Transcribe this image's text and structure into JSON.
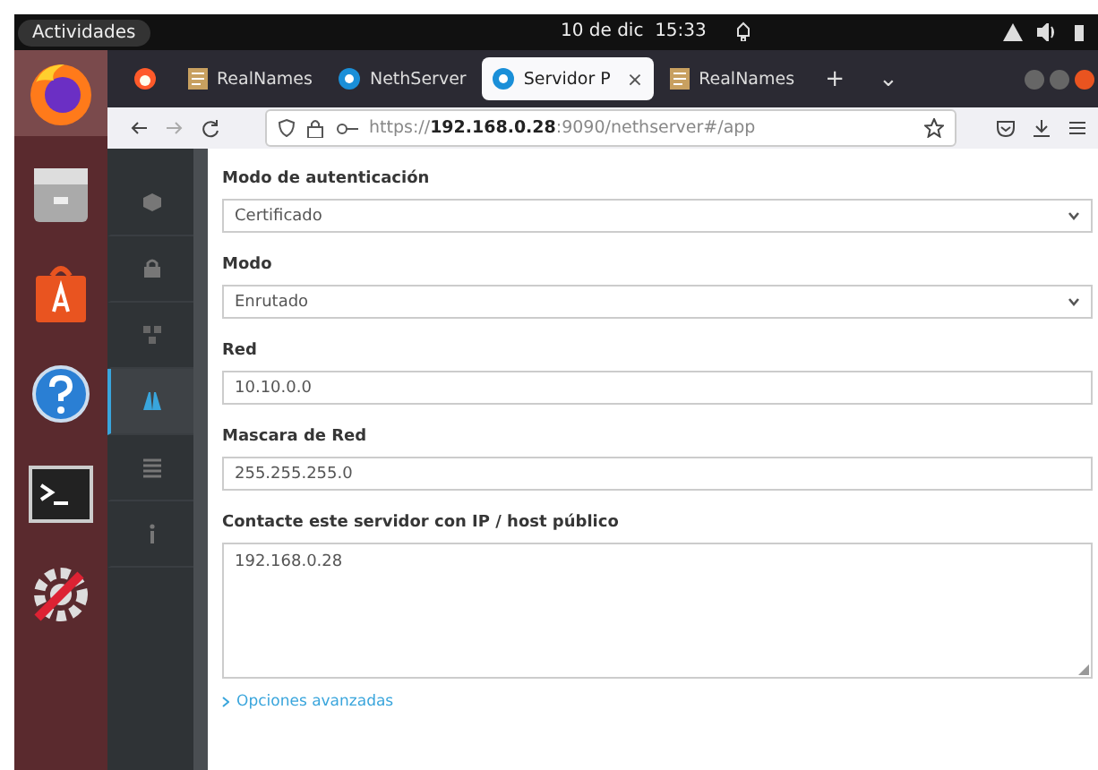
{
  "top_bar": {
    "activities": "Actividades",
    "clock": "10 de dic  15:33"
  },
  "dock": {
    "items": [
      {
        "kind": "browser",
        "selected": true
      },
      {
        "kind": "files",
        "selected": false
      },
      {
        "kind": "store",
        "selected": false
      },
      {
        "kind": "help",
        "selected": false
      },
      {
        "kind": "terminal",
        "selected": false
      },
      {
        "kind": "tools",
        "selected": false
      }
    ]
  },
  "tabs": [
    {
      "title": "RealNames",
      "kind": "doc",
      "selected": false
    },
    {
      "title": "NethServer",
      "kind": "neth",
      "selected": false
    },
    {
      "title": "Servidor P",
      "kind": "neth",
      "selected": true,
      "close": "×"
    },
    {
      "title": "RealNames",
      "kind": "doc",
      "selected": false
    }
  ],
  "new_tab": "+",
  "tab_list": "⌄",
  "address_bar": {
    "url": "https://**192.168.0.28**:9090/nethserver#/app"
  },
  "side_nav": {
    "items": [
      {
        "kind": "cube",
        "selected": false
      },
      {
        "kind": "lock",
        "selected": false
      },
      {
        "kind": "nodes",
        "selected": false
      },
      {
        "kind": "network",
        "selected": true
      },
      {
        "kind": "list",
        "selected": false
      },
      {
        "kind": "info",
        "selected": false
      }
    ]
  },
  "form": {
    "fields": [
      {
        "kind": "select",
        "label": "Modo de autenticación",
        "value": "Certificado"
      },
      {
        "kind": "select",
        "label": "Modo",
        "value": "Enrutado"
      },
      {
        "kind": "input",
        "label": "Red",
        "value": "10.10.0.0"
      },
      {
        "kind": "input",
        "label": "Mascara de Red",
        "value": "255.255.255.0"
      },
      {
        "kind": "textarea",
        "label": "Contacte este servidor con IP / host público",
        "value": "192.168.0.28"
      }
    ],
    "advanced_link": "Opciones avanzadas"
  }
}
